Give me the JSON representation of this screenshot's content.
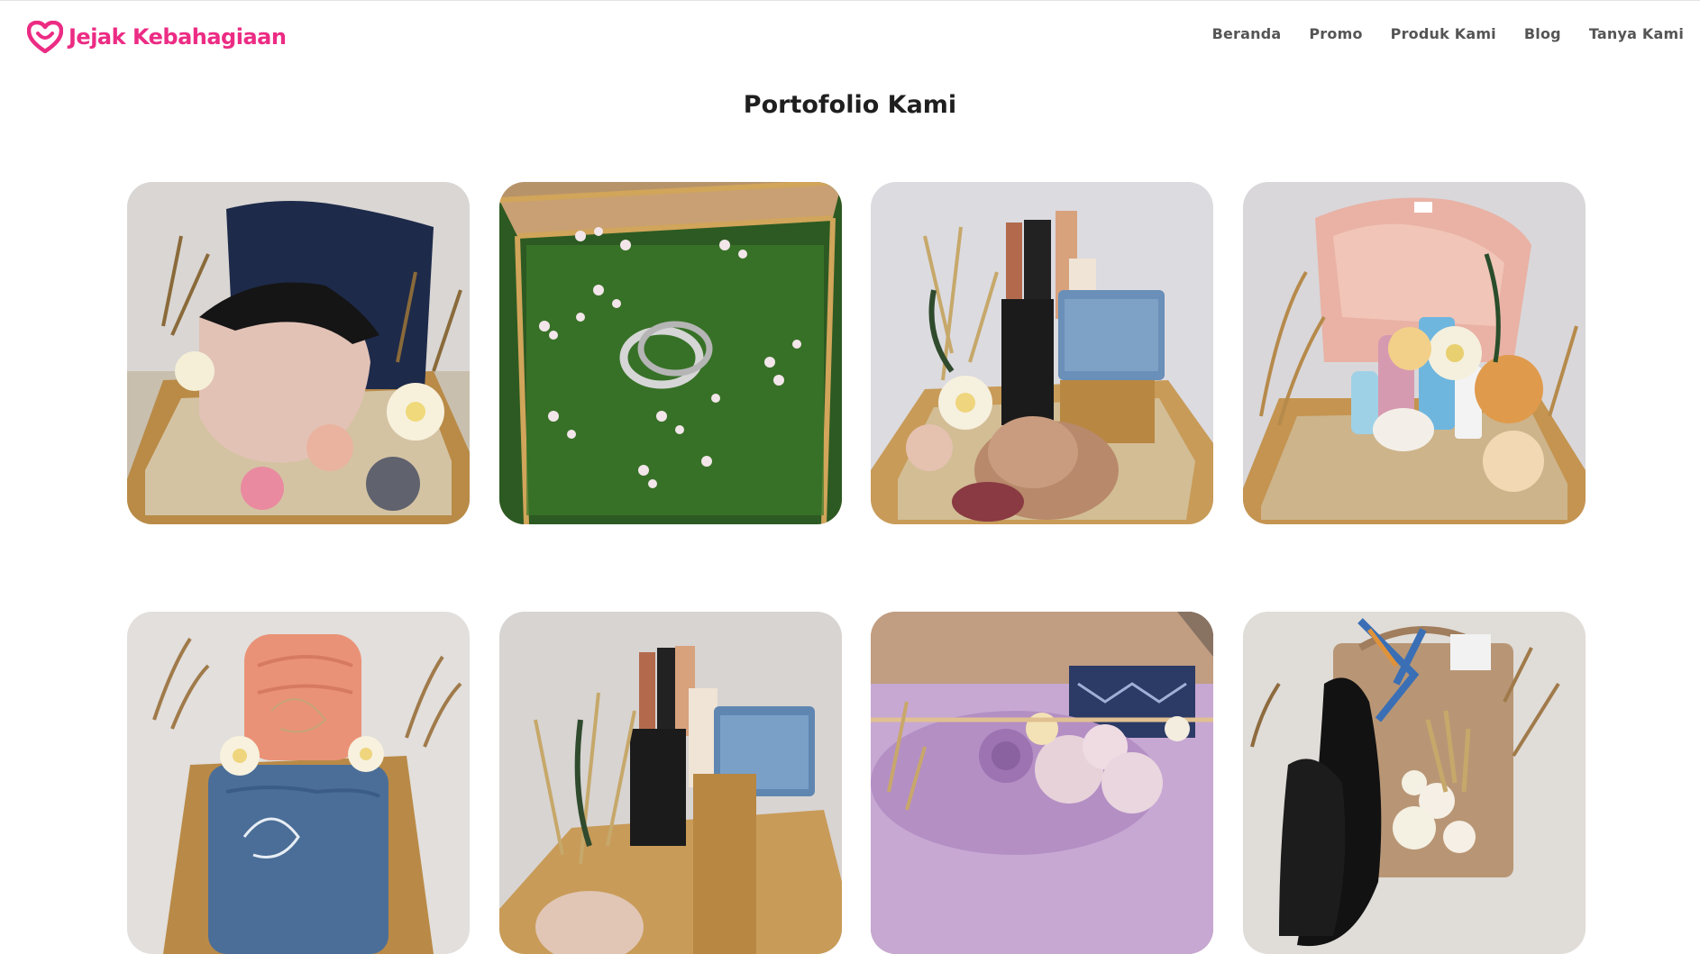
{
  "brand": {
    "name": "Jejak Kebahagiaan",
    "color": "#ec2c84",
    "icon": "heart-smile-icon"
  },
  "nav": {
    "color": "#555555",
    "items": [
      {
        "label": "Beranda"
      },
      {
        "label": "Promo"
      },
      {
        "label": "Produk Kami"
      },
      {
        "label": "Blog"
      },
      {
        "label": "Tanya Kami"
      }
    ]
  },
  "main": {
    "title": "Portofolio Kami"
  },
  "portfolio": {
    "items": [
      {
        "subject": "navy-blouse-hijab-hamper"
      },
      {
        "subject": "rings-on-moss-box"
      },
      {
        "subject": "cosmetics-hooman-hamper"
      },
      {
        "subject": "pink-shirt-skincare-hamper"
      },
      {
        "subject": "towel-hamper"
      },
      {
        "subject": "cosmetics-hooman-hamper-2"
      },
      {
        "subject": "purple-fabric-glass-box"
      },
      {
        "subject": "bag-shoes-hamper"
      }
    ]
  }
}
